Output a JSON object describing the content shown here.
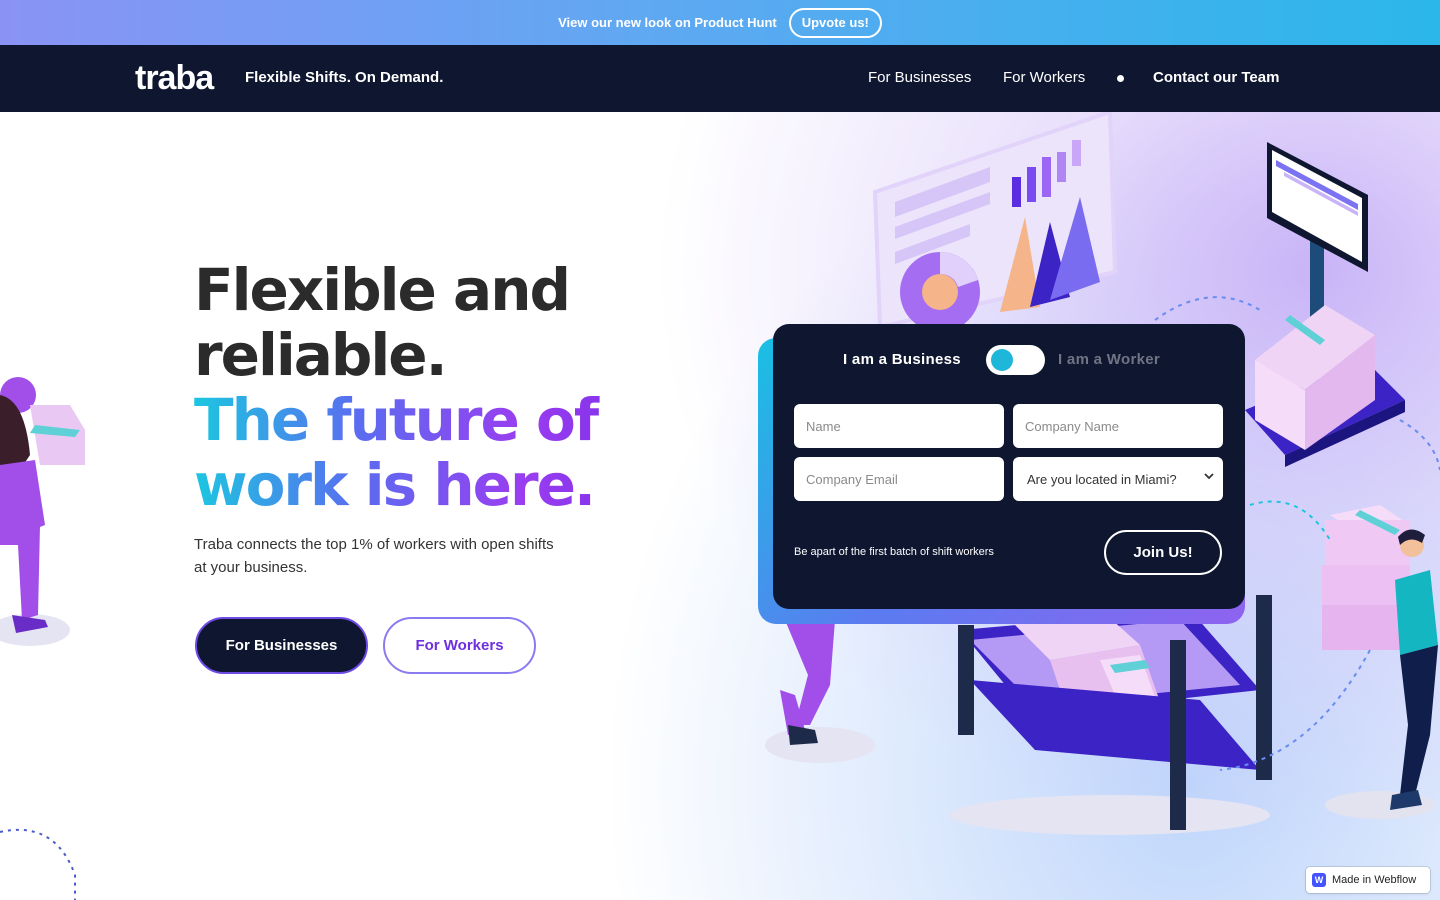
{
  "announcement": {
    "text": "View our new look on Product Hunt",
    "button_label": "Upvote us!"
  },
  "nav": {
    "logo": "traba",
    "tagline": "Flexible Shifts. On Demand.",
    "links": [
      {
        "label": "For Businesses"
      },
      {
        "label": "For Workers"
      }
    ],
    "cta_label": "Contact our Team"
  },
  "hero": {
    "headline_line1": "Flexible and",
    "headline_line2": "reliable.",
    "headline_line3": "The future of",
    "headline_line4": "work is here.",
    "subtext": "Traba connects the top 1% of workers with open shifts at your business.",
    "btn_business": "For Businesses",
    "btn_workers": "For Workers"
  },
  "form": {
    "toggle_left": "I am a Business",
    "toggle_right": "I am a Worker",
    "name_placeholder": "Name",
    "company_name_placeholder": "Company Name",
    "company_email_placeholder": "Company Email",
    "location_select": "Are you located in Miami?",
    "batch_text": "Be apart of the first batch of shift workers",
    "join_label": "Join Us!"
  },
  "badge": {
    "icon_letter": "W",
    "label": "Made in Webflow"
  },
  "colors": {
    "nav_bg": "#0f1630",
    "accent_cyan": "#1cc6e0",
    "accent_purple": "#7a2ee8"
  }
}
